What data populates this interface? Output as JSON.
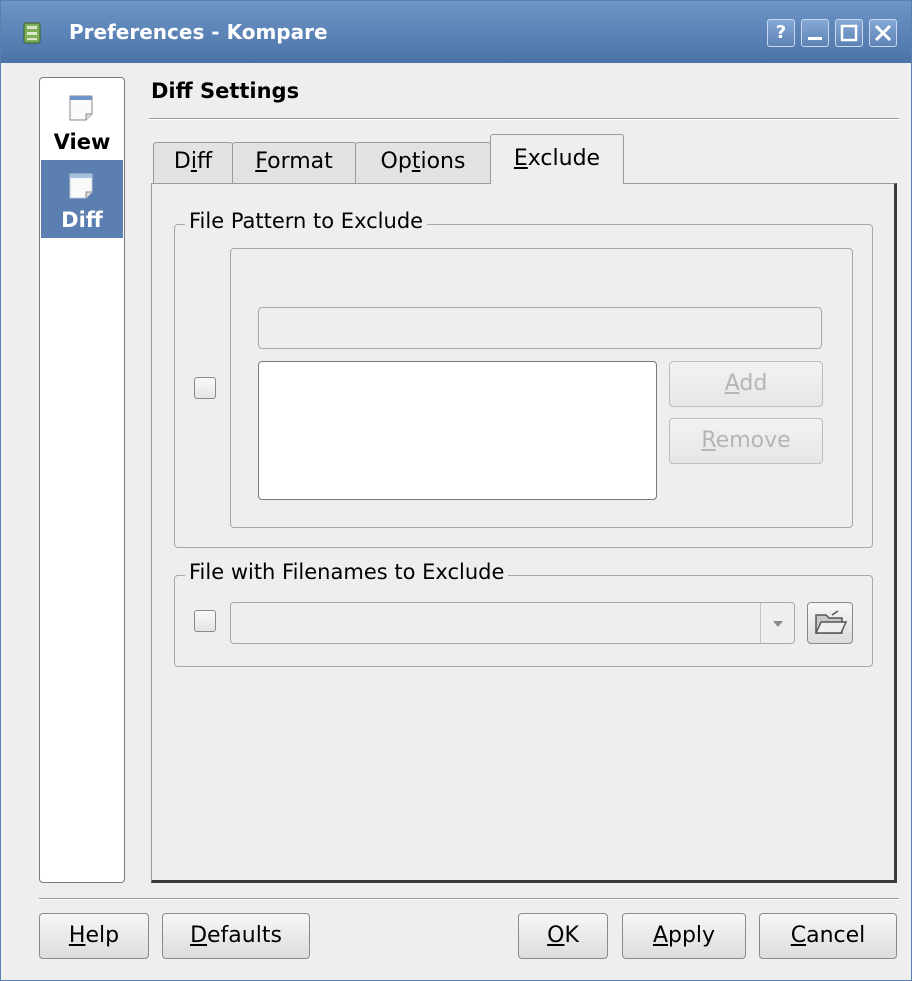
{
  "window": {
    "title": "Preferences - Kompare",
    "buttons": {
      "help": "?",
      "minimize": "_",
      "maximize": "□",
      "close": "X"
    }
  },
  "sidebar": {
    "items": [
      {
        "label": "View",
        "icon": "page-icon",
        "selected": false
      },
      {
        "label": "Diff",
        "icon": "page-icon",
        "selected": true
      }
    ]
  },
  "page": {
    "title": "Diff Settings"
  },
  "tabs": [
    {
      "pre": "D",
      "mn": "i",
      "post": "ff"
    },
    {
      "pre": "",
      "mn": "F",
      "post": "ormat"
    },
    {
      "pre": "Op",
      "mn": "t",
      "post": "ions"
    },
    {
      "pre": "",
      "mn": "E",
      "post": "xclude",
      "active": true
    }
  ],
  "exclude": {
    "pattern_group": {
      "title": "File Pattern to Exclude",
      "enabled": false,
      "pattern_input": "",
      "add": {
        "pre": "",
        "mn": "A",
        "post": "dd"
      },
      "remove": {
        "pre": "",
        "mn": "R",
        "post": "emove"
      }
    },
    "file_group": {
      "title": "File with Filenames to Exclude",
      "enabled": false,
      "file_value": "",
      "browse_icon": "folder-open-icon"
    }
  },
  "buttons": {
    "help": {
      "pre": "",
      "mn": "H",
      "post": "elp"
    },
    "defaults": {
      "pre": "",
      "mn": "D",
      "post": "efaults"
    },
    "ok": {
      "pre": "",
      "mn": "O",
      "post": "K"
    },
    "apply": {
      "pre": "",
      "mn": "A",
      "post": "pply"
    },
    "cancel": {
      "pre": "",
      "mn": "C",
      "post": "ancel"
    }
  },
  "colors": {
    "titlebar": "#5a80b2",
    "selection": "#5b7fb0"
  }
}
